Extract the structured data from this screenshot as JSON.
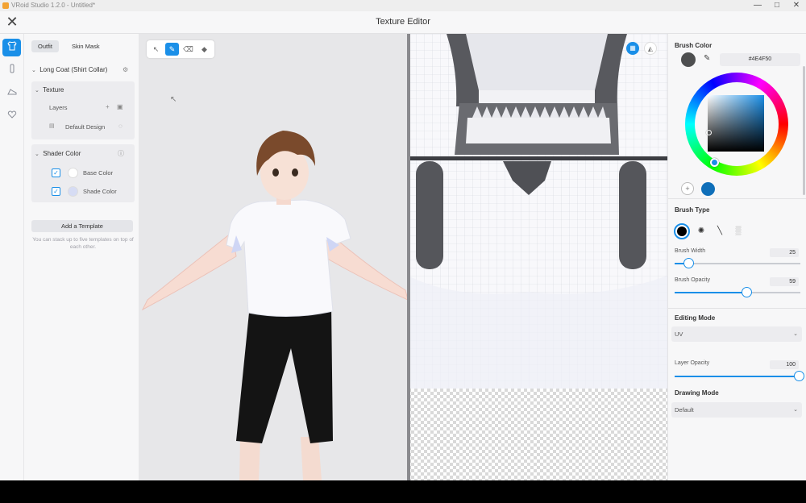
{
  "window": {
    "app_title": "VRoid Studio 1.2.0 - Untitled*",
    "controls": [
      "—",
      "□",
      "✕"
    ]
  },
  "header": {
    "title": "Texture Editor",
    "close_glyph": "✕"
  },
  "left_rail": {
    "icons": [
      "shirt-icon",
      "bottle-icon",
      "shoe-icon",
      "heart-icon"
    ]
  },
  "left_panel": {
    "tabs": [
      "Outfit",
      "Skin Mask"
    ],
    "item_title": "Long Coat (Shirt Collar)",
    "texture": {
      "label": "Texture",
      "layers_label": "Layers",
      "layer_name": "Default Design"
    },
    "shader": {
      "label": "Shader Color",
      "rows": [
        {
          "label": "Base Color",
          "color": "#ffffff"
        },
        {
          "label": "Shade Color",
          "color": "#d6dcf4"
        }
      ]
    },
    "add_template_label": "Add a Template",
    "template_help": "You can stack up to five templates on top of each other."
  },
  "viewport": {
    "tools": [
      "select-icon",
      "brush-icon",
      "eraser-icon",
      "fill-icon"
    ],
    "active_tool": "brush-icon"
  },
  "right_panel": {
    "brush_color_title": "Brush Color",
    "hex_value": "#4E4F50",
    "brush_type_title": "Brush Type",
    "brush_width_label": "Brush Width",
    "brush_width_value": "25",
    "brush_opacity_label": "Brush Opacity",
    "brush_opacity_value": "59",
    "editing_mode_title": "Editing Mode",
    "editing_mode_value": "UV",
    "layer_opacity_label": "Layer Opacity",
    "layer_opacity_value": "100",
    "drawing_mode_title": "Drawing Mode",
    "drawing_mode_value": "Default"
  },
  "colors": {
    "accent": "#1a8fe8",
    "brush_color": "#4e4f50"
  }
}
